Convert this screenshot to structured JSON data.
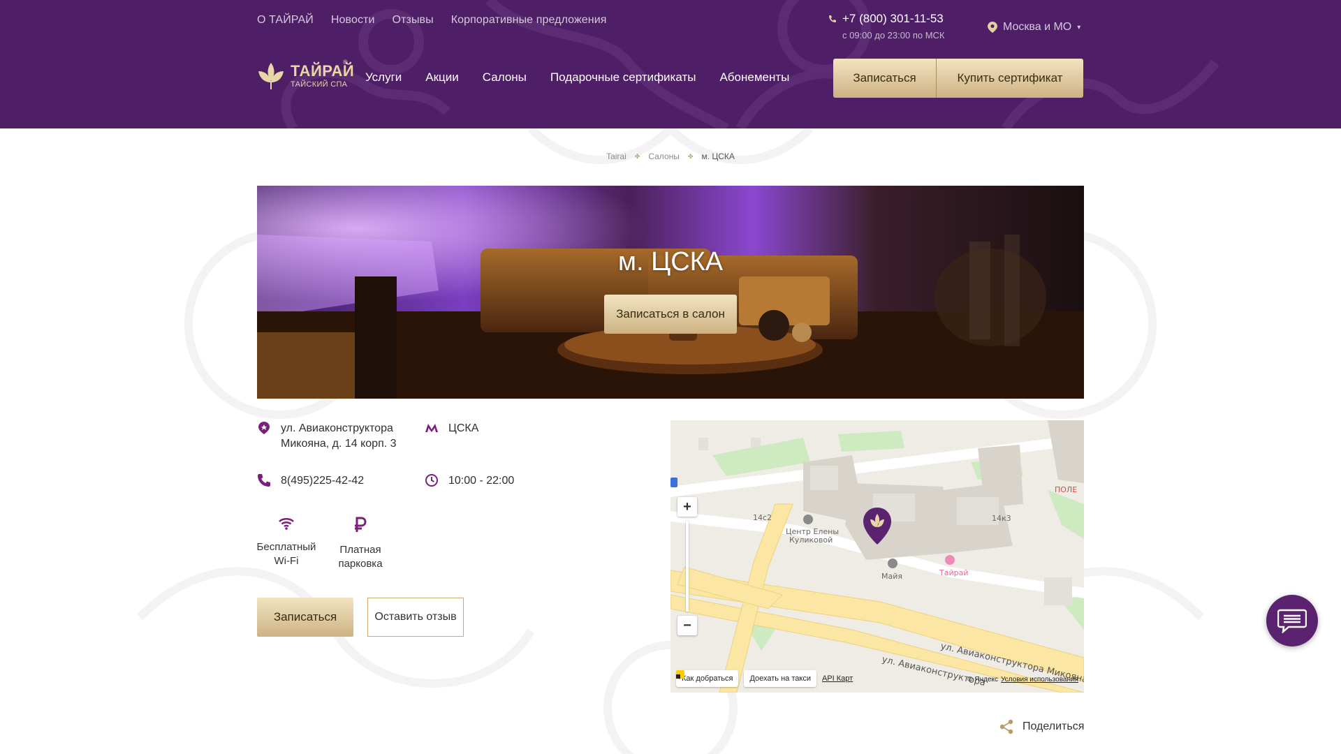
{
  "header": {
    "top_links": [
      "О ТАЙРАЙ",
      "Новости",
      "Отзывы",
      "Корпоративные предложения"
    ],
    "phone": "+7 (800) 301-11-53",
    "hours": "с 09:00 до 23:00 по МСК",
    "region": "Москва и МО",
    "logo_main": "ТАЙРАЙ",
    "logo_sub": "ТАЙСКИЙ СПА",
    "logo_reg": "®",
    "main_nav": [
      "Услуги",
      "Акции",
      "Салоны",
      "Подарочные сертификаты",
      "Абонементы"
    ],
    "book_label": "Записаться",
    "buy_cert_label": "Купить сертификат",
    "colors": {
      "background": "#4e1f67",
      "gold_light": "#f2e4c0",
      "gold_dark": "#cdb283",
      "accent_purple": "#7a1f7a"
    }
  },
  "breadcrumb": [
    "Tairai",
    "Салоны",
    "м. ЦСКА"
  ],
  "hero": {
    "title": "м. ЦСКА",
    "button_label": "Записаться в салон"
  },
  "salon": {
    "address_line1": "ул. Авиаконструктора",
    "address_line2": "Микояна, д. 14 корп. 3",
    "metro": "ЦСКА",
    "phone": "8(495)225-42-42",
    "hours": "10:00 - 22:00",
    "amenities": [
      {
        "icon": "wifi-icon",
        "line1": "Бесплатный",
        "line2": "Wi-Fi"
      },
      {
        "icon": "ruble-icon",
        "line1": "Платная",
        "line2": "парковка"
      }
    ],
    "book_label": "Записаться",
    "review_label": "Оставить отзыв"
  },
  "map": {
    "zoom_in": "+",
    "zoom_out": "−",
    "directions_label": "Как добраться",
    "taxi_label": "Доехать на такси",
    "api_label": "API Карт",
    "copyright": "© Яндекс",
    "terms": "Условия использования",
    "labels": {
      "street": "ул. Авиаконструктора Микояна",
      "street_short": "ул. Авиаконструктора",
      "b1": "14с2",
      "b2": "14к3",
      "center": "Центр Елены",
      "center2": "Куликовой",
      "maya": "Майя",
      "tairai": "Тайрай",
      "pole": "ПОЛЕ"
    }
  },
  "share_label": "Поделиться"
}
